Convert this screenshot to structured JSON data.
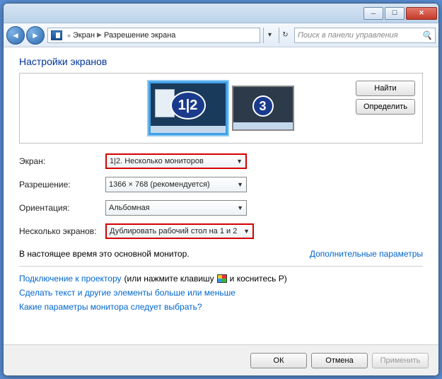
{
  "window": {
    "minimize_icon": "─",
    "maximize_icon": "☐",
    "close_icon": "✕"
  },
  "nav": {
    "back_icon": "◄",
    "forward_icon": "►",
    "crumb1": "Экран",
    "crumb2": "Разрешение экрана",
    "dropdown_icon": "▾",
    "refresh_icon": "↻",
    "search_placeholder": "Поиск в панели управления",
    "search_icon": "🔍"
  },
  "page": {
    "title": "Настройки экранов"
  },
  "monitors": {
    "label12": "1|2",
    "label3": "3",
    "find_btn": "Найти",
    "detect_btn": "Определить"
  },
  "form": {
    "screen_label": "Экран:",
    "screen_value": "1|2. Несколько мониторов",
    "resolution_label": "Разрешение:",
    "resolution_value": "1366 × 768 (рекомендуется)",
    "orientation_label": "Ориентация:",
    "orientation_value": "Альбомная",
    "multi_label": "Несколько экранов:",
    "multi_value": "Дублировать рабочий стол на 1 и 2"
  },
  "status": {
    "main_text": "В настоящее время это основной монитор.",
    "extra_link": "Дополнительные параметры"
  },
  "links": {
    "projector_link": "Подключение к проектору",
    "projector_tail1": "(или нажмите клавишу",
    "projector_tail2": "и коснитесь P)",
    "text_size": "Сделать текст и другие элементы больше или меньше",
    "which_params": "Какие параметры монитора следует выбрать?"
  },
  "footer": {
    "ok": "ОК",
    "cancel": "Отмена",
    "apply": "Применить"
  }
}
